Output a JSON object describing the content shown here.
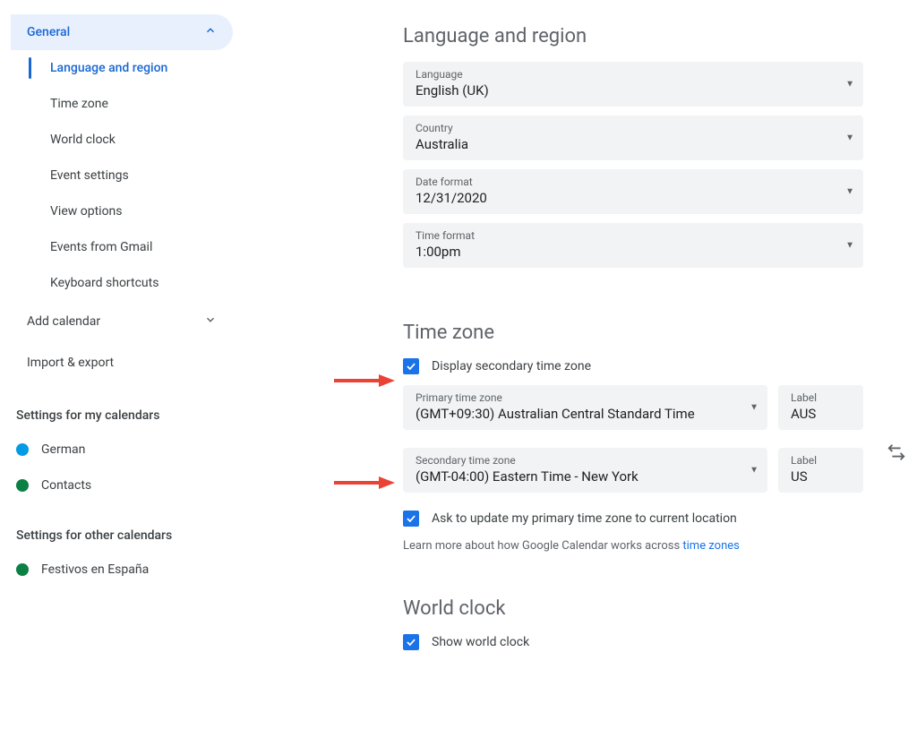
{
  "sidebar": {
    "general": "General",
    "sub": {
      "lang": "Language and region",
      "tz": "Time zone",
      "wc": "World clock",
      "ev": "Event settings",
      "vo": "View options",
      "efg": "Events from Gmail",
      "ks": "Keyboard shortcuts"
    },
    "addcal": "Add calendar",
    "import": "Import & export",
    "mycal_heading": "Settings for my calendars",
    "mycal": {
      "german": "German",
      "contacts": "Contacts"
    },
    "othercal_heading": "Settings for other calendars",
    "othercal": {
      "fest": "Festivos en España"
    },
    "colors": {
      "german": "#039be5",
      "contacts": "#0b8043",
      "fest": "#0b8043"
    }
  },
  "lang_section": {
    "title": "Language and region",
    "language_label": "Language",
    "language_value": "English (UK)",
    "country_label": "Country",
    "country_value": "Australia",
    "datefmt_label": "Date format",
    "datefmt_value": "12/31/2020",
    "timefmt_label": "Time format",
    "timefmt_value": "1:00pm"
  },
  "tz_section": {
    "title": "Time zone",
    "display_secondary": "Display secondary time zone",
    "primary_label": "Primary time zone",
    "primary_value": "(GMT+09:30) Australian Central Standard Time",
    "primary_label_field": "Label",
    "primary_label_value": "AUS",
    "secondary_label": "Secondary time zone",
    "secondary_value": "(GMT-04:00) Eastern Time - New York",
    "secondary_label_field": "Label",
    "secondary_label_value": "US",
    "ask_update": "Ask to update my primary time zone to current location",
    "helper_pre": "Learn more about how Google Calendar works across ",
    "helper_link": "time zones"
  },
  "wc_section": {
    "title": "World clock",
    "show": "Show world clock"
  }
}
